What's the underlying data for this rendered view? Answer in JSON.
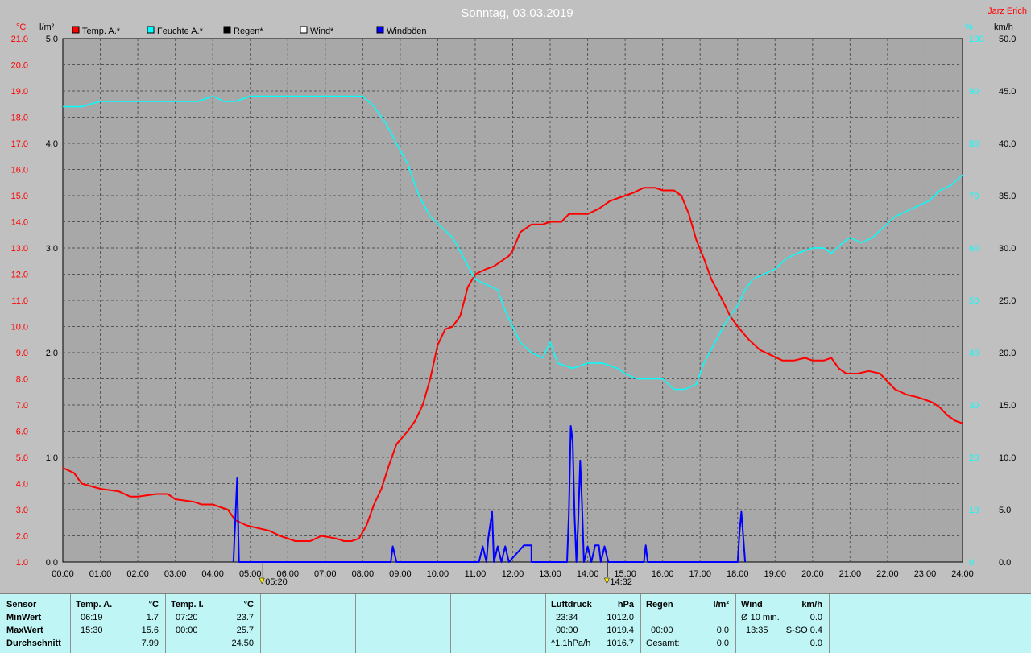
{
  "title": "Sonntag, 03.03.2019",
  "author": "Jarz Erich",
  "axes": {
    "left1_unit": "°C",
    "left2_unit": "l/m²",
    "right1_unit": "%",
    "right2_unit": "km/h",
    "temp_ticks": [
      "21.0",
      "20.0",
      "19.0",
      "18.0",
      "17.0",
      "16.0",
      "15.0",
      "14.0",
      "13.0",
      "12.0",
      "11.0",
      "10.0",
      "9.0",
      "8.0",
      "7.0",
      "6.0",
      "5.0",
      "4.0",
      "3.0",
      "2.0",
      "1.0"
    ],
    "rain_ticks": [
      "5.0",
      "4.0",
      "3.0",
      "2.0",
      "1.0",
      "0.0"
    ],
    "hum_ticks": [
      "100",
      "90",
      "80",
      "70",
      "60",
      "50",
      "40",
      "30",
      "20",
      "10",
      "0"
    ],
    "wind_ticks": [
      "50.0",
      "45.0",
      "40.0",
      "35.0",
      "30.0",
      "25.0",
      "20.0",
      "15.0",
      "10.0",
      "5.0",
      "0.0"
    ],
    "time_ticks": [
      "00:00",
      "01:00",
      "02:00",
      "03:00",
      "04:00",
      "05:00",
      "06:00",
      "07:00",
      "08:00",
      "09:00",
      "10:00",
      "11:00",
      "12:00",
      "13:00",
      "14:00",
      "15:00",
      "16:00",
      "17:00",
      "18:00",
      "19:00",
      "20:00",
      "21:00",
      "22:00",
      "23:00",
      "24:00"
    ],
    "sunrise": "05:20",
    "sunset": "14:32"
  },
  "legend": [
    {
      "label": "Temp. A.*",
      "color": "#ff0000"
    },
    {
      "label": "Feuchte A.*",
      "color": "#00ffff"
    },
    {
      "label": "Regen*",
      "color": "#000000"
    },
    {
      "label": "Wind*",
      "color": "#ffffff"
    },
    {
      "label": "Windböen",
      "color": "#0000ff"
    }
  ],
  "chart_data": {
    "type": "line",
    "title": "Sonntag, 03.03.2019",
    "x_range": [
      "00:00",
      "24:00"
    ],
    "ylim_temp": [
      1.0,
      21.0
    ],
    "ylim_rain": [
      0.0,
      5.0
    ],
    "ylim_humidity": [
      0,
      100
    ],
    "ylim_wind": [
      0.0,
      50.0
    ],
    "grid": true,
    "series": [
      {
        "name": "Temp. A.*",
        "axis": "temp",
        "color": "#ff0000",
        "points": [
          [
            0,
            4.6
          ],
          [
            0.3,
            4.4
          ],
          [
            0.5,
            4.0
          ],
          [
            1,
            3.8
          ],
          [
            1.5,
            3.7
          ],
          [
            1.8,
            3.5
          ],
          [
            2,
            3.5
          ],
          [
            2.5,
            3.6
          ],
          [
            2.8,
            3.6
          ],
          [
            3,
            3.4
          ],
          [
            3.5,
            3.3
          ],
          [
            3.7,
            3.2
          ],
          [
            4,
            3.2
          ],
          [
            4.2,
            3.1
          ],
          [
            4.4,
            3.0
          ],
          [
            4.6,
            2.6
          ],
          [
            4.9,
            2.4
          ],
          [
            5.2,
            2.3
          ],
          [
            5.5,
            2.2
          ],
          [
            5.8,
            2.0
          ],
          [
            6.2,
            1.8
          ],
          [
            6.6,
            1.8
          ],
          [
            6.9,
            2.0
          ],
          [
            7.3,
            1.9
          ],
          [
            7.5,
            1.8
          ],
          [
            7.7,
            1.8
          ],
          [
            7.9,
            1.9
          ],
          [
            8.1,
            2.4
          ],
          [
            8.3,
            3.2
          ],
          [
            8.5,
            3.8
          ],
          [
            8.7,
            4.7
          ],
          [
            8.9,
            5.5
          ],
          [
            9.2,
            6.0
          ],
          [
            9.4,
            6.4
          ],
          [
            9.6,
            7.0
          ],
          [
            9.8,
            8.0
          ],
          [
            10,
            9.3
          ],
          [
            10.2,
            9.9
          ],
          [
            10.4,
            10.0
          ],
          [
            10.6,
            10.4
          ],
          [
            10.8,
            11.5
          ],
          [
            11,
            12.0
          ],
          [
            11.3,
            12.2
          ],
          [
            11.5,
            12.3
          ],
          [
            11.7,
            12.5
          ],
          [
            11.9,
            12.7
          ],
          [
            12,
            12.9
          ],
          [
            12.2,
            13.6
          ],
          [
            12.5,
            13.9
          ],
          [
            12.8,
            13.9
          ],
          [
            13,
            14.0
          ],
          [
            13.3,
            14.0
          ],
          [
            13.5,
            14.3
          ],
          [
            14,
            14.3
          ],
          [
            14.3,
            14.5
          ],
          [
            14.6,
            14.8
          ],
          [
            15,
            15.0
          ],
          [
            15.2,
            15.1
          ],
          [
            15.5,
            15.3
          ],
          [
            15.8,
            15.3
          ],
          [
            16,
            15.2
          ],
          [
            16.3,
            15.2
          ],
          [
            16.5,
            15.0
          ],
          [
            16.7,
            14.3
          ],
          [
            16.9,
            13.3
          ],
          [
            17.1,
            12.6
          ],
          [
            17.3,
            11.8
          ],
          [
            17.6,
            11.0
          ],
          [
            17.8,
            10.4
          ],
          [
            18,
            10.0
          ],
          [
            18.3,
            9.5
          ],
          [
            18.6,
            9.1
          ],
          [
            18.9,
            8.9
          ],
          [
            19.2,
            8.7
          ],
          [
            19.5,
            8.7
          ],
          [
            19.8,
            8.8
          ],
          [
            20,
            8.7
          ],
          [
            20.3,
            8.7
          ],
          [
            20.5,
            8.8
          ],
          [
            20.7,
            8.4
          ],
          [
            20.9,
            8.2
          ],
          [
            21.2,
            8.2
          ],
          [
            21.5,
            8.3
          ],
          [
            21.8,
            8.2
          ],
          [
            22,
            7.9
          ],
          [
            22.2,
            7.6
          ],
          [
            22.5,
            7.4
          ],
          [
            22.8,
            7.3
          ],
          [
            23,
            7.2
          ],
          [
            23.2,
            7.1
          ],
          [
            23.4,
            6.9
          ],
          [
            23.6,
            6.6
          ],
          [
            23.8,
            6.4
          ],
          [
            24,
            6.3
          ]
        ]
      },
      {
        "name": "Feuchte A.*",
        "axis": "humidity",
        "color": "#00ffff",
        "points": [
          [
            0,
            87
          ],
          [
            0.5,
            87
          ],
          [
            1,
            88
          ],
          [
            2,
            88
          ],
          [
            3,
            88
          ],
          [
            3.6,
            88
          ],
          [
            4,
            89
          ],
          [
            4.3,
            88
          ],
          [
            4.6,
            88
          ],
          [
            5,
            89
          ],
          [
            6,
            89
          ],
          [
            7,
            89
          ],
          [
            7.6,
            89
          ],
          [
            8,
            89
          ],
          [
            8.3,
            87
          ],
          [
            8.6,
            84
          ],
          [
            8.9,
            80
          ],
          [
            9.2,
            76
          ],
          [
            9.5,
            70
          ],
          [
            9.8,
            66
          ],
          [
            10.1,
            64
          ],
          [
            10.4,
            62
          ],
          [
            10.7,
            58
          ],
          [
            11,
            54
          ],
          [
            11.3,
            53
          ],
          [
            11.6,
            52
          ],
          [
            11.8,
            48
          ],
          [
            12,
            45
          ],
          [
            12.2,
            42
          ],
          [
            12.5,
            40
          ],
          [
            12.8,
            39
          ],
          [
            13,
            42
          ],
          [
            13,
            42
          ],
          [
            13,
            42
          ],
          [
            13.2,
            38
          ],
          [
            13.6,
            37
          ],
          [
            14,
            38
          ],
          [
            14.4,
            38
          ],
          [
            14.8,
            37
          ],
          [
            15,
            36
          ],
          [
            15.3,
            35
          ],
          [
            15.6,
            35
          ],
          [
            16,
            35
          ],
          [
            16.3,
            33
          ],
          [
            16.6,
            33
          ],
          [
            16.9,
            34
          ],
          [
            17.1,
            38
          ],
          [
            17.4,
            42
          ],
          [
            17.7,
            46
          ],
          [
            18,
            49
          ],
          [
            18.2,
            52
          ],
          [
            18.4,
            54
          ],
          [
            18.7,
            55
          ],
          [
            19,
            56
          ],
          [
            19.3,
            58
          ],
          [
            19.6,
            59
          ],
          [
            20,
            60
          ],
          [
            20.3,
            60
          ],
          [
            20.5,
            59
          ],
          [
            20.8,
            61
          ],
          [
            21,
            62
          ],
          [
            21.3,
            61
          ],
          [
            21.6,
            62
          ],
          [
            21.9,
            64
          ],
          [
            22.2,
            66
          ],
          [
            22.5,
            67
          ],
          [
            22.8,
            68
          ],
          [
            23.1,
            69
          ],
          [
            23.4,
            71
          ],
          [
            23.7,
            72
          ],
          [
            24,
            74
          ]
        ]
      },
      {
        "name": "Windböen",
        "axis": "wind",
        "color": "#0000ff",
        "points": [
          [
            4.55,
            0
          ],
          [
            4.6,
            3.9
          ],
          [
            4.65,
            8.0
          ],
          [
            4.7,
            0
          ],
          [
            8.75,
            0
          ],
          [
            8.8,
            1.5
          ],
          [
            8.9,
            0
          ],
          [
            11.1,
            0
          ],
          [
            11.2,
            1.5
          ],
          [
            11.3,
            0
          ],
          [
            11.35,
            2.3
          ],
          [
            11.45,
            4.8
          ],
          [
            11.5,
            0
          ],
          [
            11.6,
            1.5
          ],
          [
            11.7,
            0
          ],
          [
            11.8,
            1.5
          ],
          [
            11.9,
            0
          ],
          [
            12.3,
            1.6
          ],
          [
            12.5,
            1.6
          ],
          [
            12.5,
            0
          ],
          [
            13.45,
            0
          ],
          [
            13.5,
            4.8
          ],
          [
            13.55,
            13.0
          ],
          [
            13.6,
            11.5
          ],
          [
            13.65,
            4.5
          ],
          [
            13.7,
            0
          ],
          [
            13.75,
            4.0
          ],
          [
            13.8,
            9.7
          ],
          [
            13.85,
            5.5
          ],
          [
            13.9,
            0
          ],
          [
            14,
            1.5
          ],
          [
            14.1,
            0
          ],
          [
            14.2,
            1.6
          ],
          [
            14.3,
            1.6
          ],
          [
            14.35,
            0
          ],
          [
            14.45,
            1.5
          ],
          [
            14.55,
            0
          ],
          [
            15.5,
            0
          ],
          [
            15.55,
            1.6
          ],
          [
            15.6,
            0
          ],
          [
            18,
            0
          ],
          [
            18.05,
            2.8
          ],
          [
            18.1,
            4.8
          ],
          [
            18.15,
            2.5
          ],
          [
            18.2,
            0
          ]
        ]
      }
    ]
  },
  "table": {
    "sensor": {
      "header": "Sensor",
      "row1": "MinWert",
      "row2": "MaxWert",
      "row3": "Durchschnitt"
    },
    "temp_a": {
      "header": "Temp. A.",
      "unit": "°C",
      "min_time": "06:19",
      "min_val": "1.7",
      "max_time": "15:30",
      "max_val": "15.6",
      "avg": "7.99"
    },
    "temp_i": {
      "header": "Temp. I.",
      "unit": "°C",
      "min_time": "07:20",
      "min_val": "23.7",
      "max_time": "00:00",
      "max_val": "25.7",
      "avg": "24.50"
    },
    "pressure": {
      "header": "Luftdruck",
      "unit": "hPa",
      "min_time": "23:34",
      "min_val": "1012.0",
      "max_time": "00:00",
      "max_val": "1019.4",
      "trend_label": "^1.1hPa/h",
      "trend_val": "1016.7"
    },
    "rain": {
      "header": "Regen",
      "unit": "l/m²",
      "max_time": "00:00",
      "max_val": "0.0",
      "total_label": "Gesamt:",
      "total_val": "0.0"
    },
    "wind": {
      "header": "Wind",
      "unit": "km/h",
      "avg_label": "Ø 10 min.",
      "avg_val": "0.0",
      "max_time": "13:35",
      "max_dir": "S-SO 0.4",
      "last_val": "0.0"
    }
  }
}
